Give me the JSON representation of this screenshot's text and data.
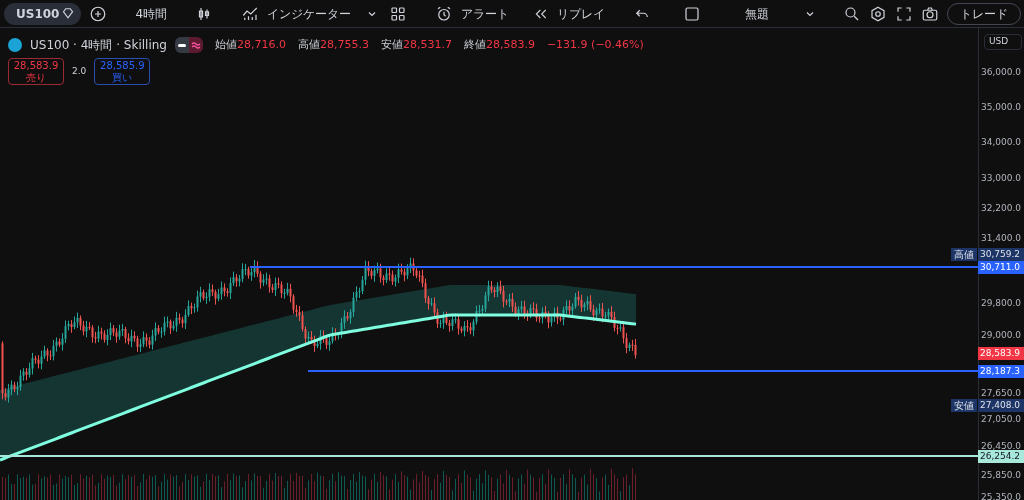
{
  "toolbar": {
    "symbol": "US100",
    "interval": "4時間",
    "indicators": "インジケーター",
    "alert": "アラート",
    "replay": "リプレイ",
    "layout_name": "無題",
    "trade": "トレード"
  },
  "legend": {
    "title": "US100 · 4時間 · Skilling",
    "ohlc": [
      {
        "label": "始値",
        "value": "28,716.0"
      },
      {
        "label": "高値",
        "value": "28,755.3"
      },
      {
        "label": "安値",
        "value": "28,531.7"
      },
      {
        "label": "終値",
        "value": "28,583.9"
      }
    ],
    "change": "−131.9 (−0.46%)",
    "sell": {
      "price": "28,583.9",
      "label": "売り"
    },
    "spread": "2.0",
    "buy": {
      "price": "28,585.9",
      "label": "買い"
    }
  },
  "price_axis": {
    "currency": "USD",
    "labels": [
      "36,000.0",
      "35,000.0",
      "34,000.0",
      "33,000.0",
      "32,200.0",
      "31,400.0",
      "29,800.0",
      "29,000.0",
      "27,650.0",
      "27,050.0",
      "26,450.0",
      "25,850.0",
      "25,350.0"
    ],
    "tags": [
      {
        "kind": "high",
        "label": "高値",
        "value": "30,759.2"
      },
      {
        "kind": "line",
        "value": "30,711.0"
      },
      {
        "kind": "last",
        "value": "28,583.9"
      },
      {
        "kind": "line",
        "value": "28,187.3"
      },
      {
        "kind": "low",
        "label": "安値",
        "value": "27,408.0"
      },
      {
        "kind": "teal",
        "value": "26,254.2"
      }
    ]
  }
}
